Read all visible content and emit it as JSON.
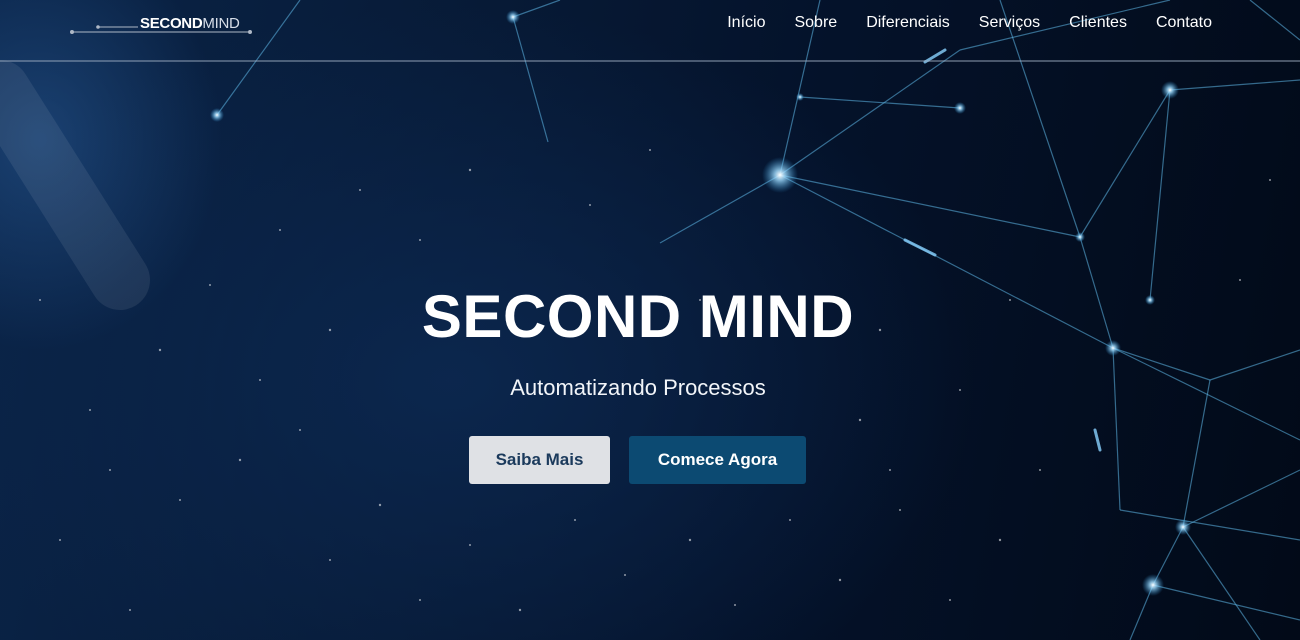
{
  "brand": {
    "logo_bold": "SECOND",
    "logo_light": "MIND"
  },
  "nav": {
    "items": [
      {
        "label": "Início"
      },
      {
        "label": "Sobre"
      },
      {
        "label": "Diferenciais"
      },
      {
        "label": "Serviços"
      },
      {
        "label": "Clientes"
      },
      {
        "label": "Contato"
      }
    ]
  },
  "hero": {
    "title": "SECOND MIND",
    "subtitle": "Automatizando Processos",
    "primary_button": "Saiba Mais",
    "secondary_button": "Comece Agora"
  },
  "colors": {
    "background_dark": "#04101f",
    "button_light": "#dfe1e5",
    "button_dark": "#0c4a72",
    "network_line": "#5fb8e8"
  }
}
